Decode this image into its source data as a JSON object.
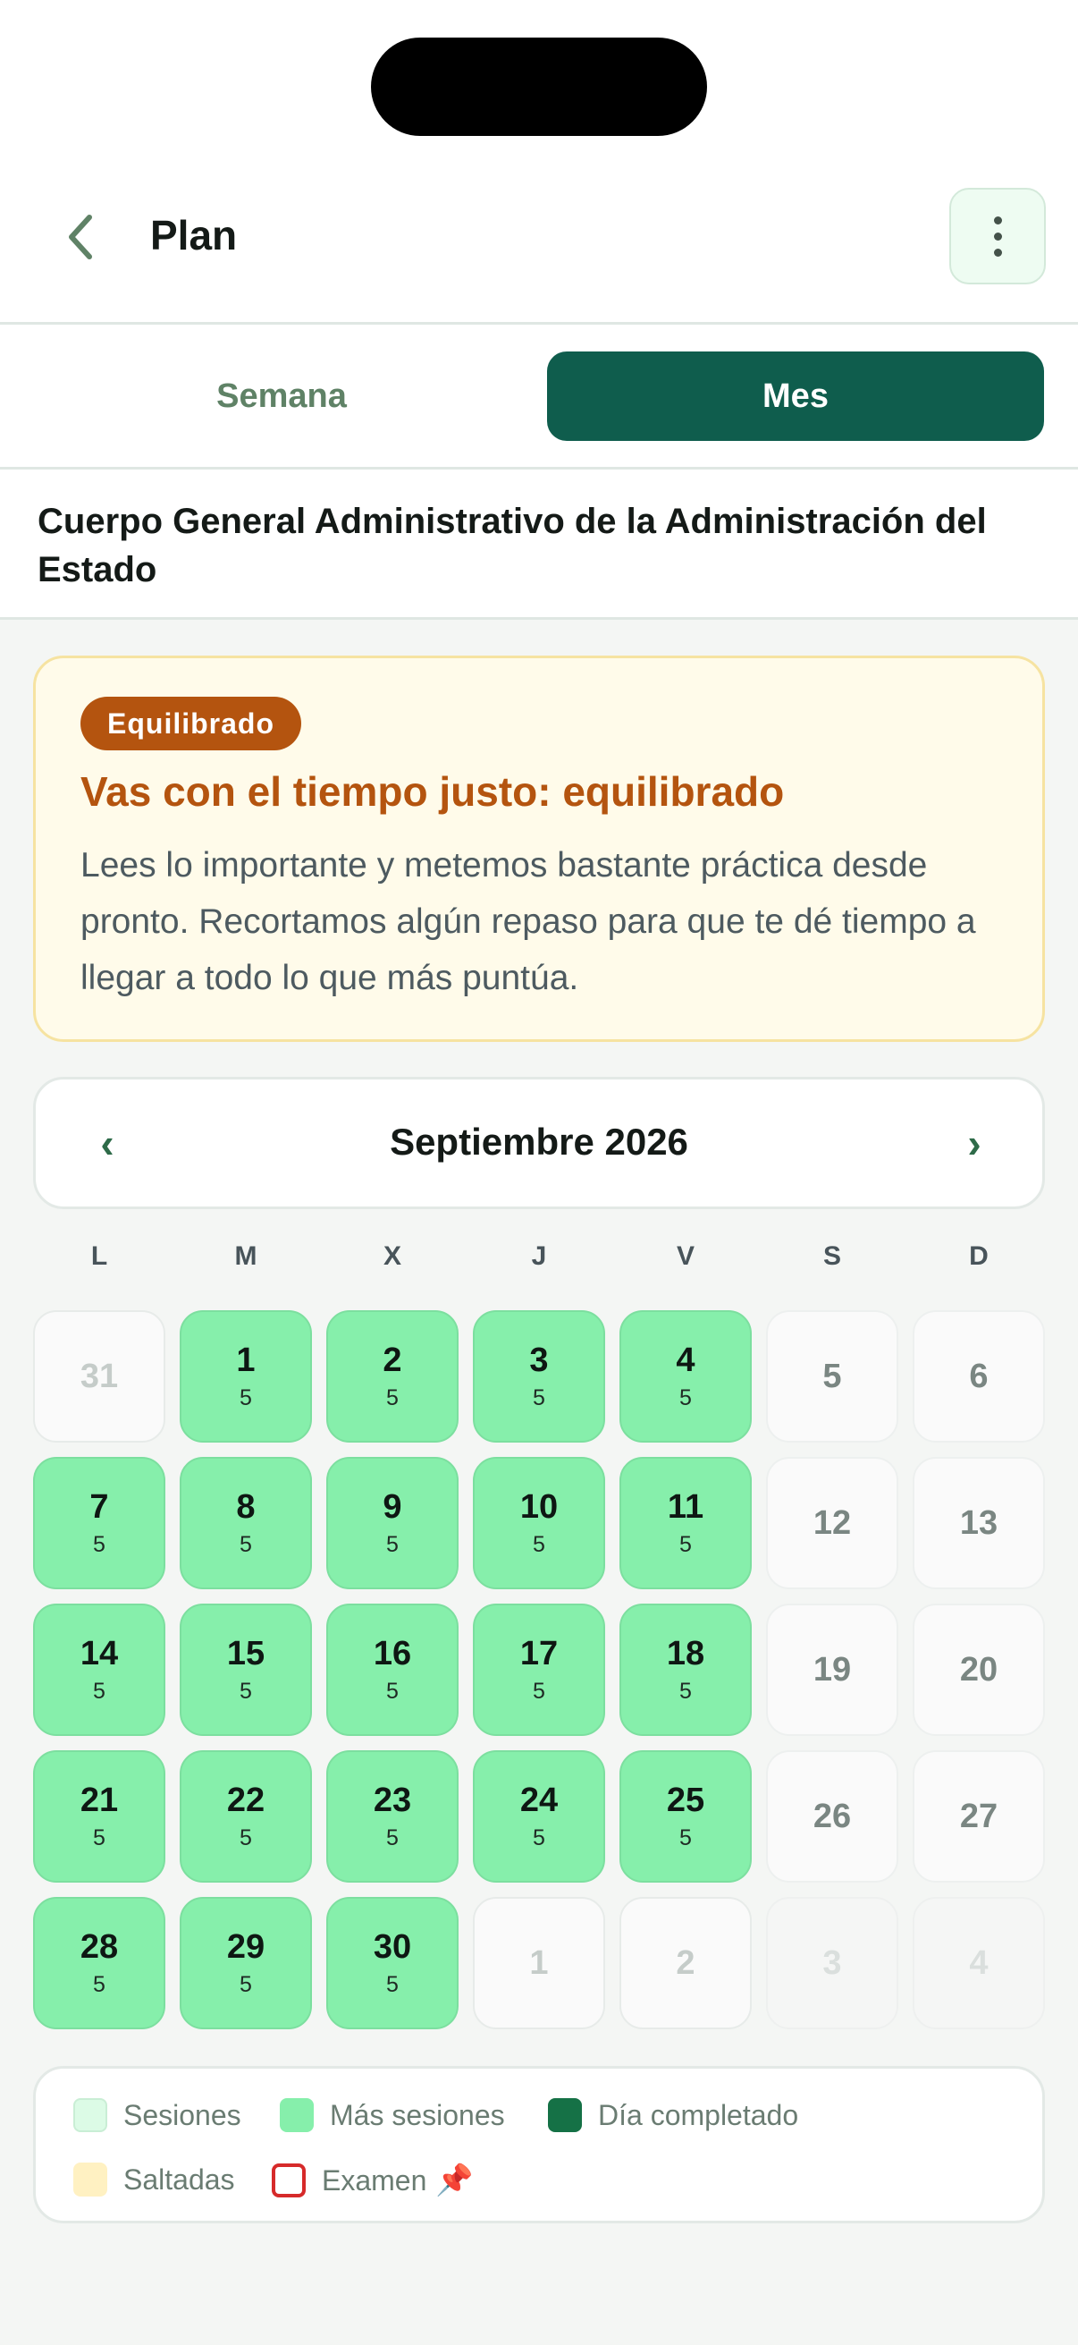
{
  "header": {
    "title": "Plan"
  },
  "tabs": [
    {
      "label": "Semana",
      "active": false
    },
    {
      "label": "Mes",
      "active": true
    }
  ],
  "subtitle": "Cuerpo General Administrativo de la Administración del Estado",
  "notice": {
    "badge": "Equilibrado",
    "title": "Vas con el tiempo justo: equilibrado",
    "body": "Lees lo importante y metemos bastante práctica desde pronto. Recortamos algún repaso para que te dé tiempo a llegar a todo lo que más puntúa."
  },
  "calendar": {
    "month_label": "Septiembre 2026",
    "prev_symbol": "‹",
    "next_symbol": "›",
    "weekdays": [
      "L",
      "M",
      "X",
      "J",
      "V",
      "S",
      "D"
    ],
    "weeks": [
      [
        {
          "day": "31",
          "count": "",
          "state": "outside"
        },
        {
          "day": "1",
          "count": "5",
          "state": "active"
        },
        {
          "day": "2",
          "count": "5",
          "state": "active"
        },
        {
          "day": "3",
          "count": "5",
          "state": "active"
        },
        {
          "day": "4",
          "count": "5",
          "state": "active"
        },
        {
          "day": "5",
          "count": "",
          "state": "weekend"
        },
        {
          "day": "6",
          "count": "",
          "state": "weekend"
        }
      ],
      [
        {
          "day": "7",
          "count": "5",
          "state": "active"
        },
        {
          "day": "8",
          "count": "5",
          "state": "active"
        },
        {
          "day": "9",
          "count": "5",
          "state": "active"
        },
        {
          "day": "10",
          "count": "5",
          "state": "active"
        },
        {
          "day": "11",
          "count": "5",
          "state": "active"
        },
        {
          "day": "12",
          "count": "",
          "state": "weekend"
        },
        {
          "day": "13",
          "count": "",
          "state": "weekend"
        }
      ],
      [
        {
          "day": "14",
          "count": "5",
          "state": "active"
        },
        {
          "day": "15",
          "count": "5",
          "state": "active"
        },
        {
          "day": "16",
          "count": "5",
          "state": "active"
        },
        {
          "day": "17",
          "count": "5",
          "state": "active"
        },
        {
          "day": "18",
          "count": "5",
          "state": "active"
        },
        {
          "day": "19",
          "count": "",
          "state": "weekend"
        },
        {
          "day": "20",
          "count": "",
          "state": "weekend"
        }
      ],
      [
        {
          "day": "21",
          "count": "5",
          "state": "active"
        },
        {
          "day": "22",
          "count": "5",
          "state": "active"
        },
        {
          "day": "23",
          "count": "5",
          "state": "active"
        },
        {
          "day": "24",
          "count": "5",
          "state": "active"
        },
        {
          "day": "25",
          "count": "5",
          "state": "active"
        },
        {
          "day": "26",
          "count": "",
          "state": "weekend"
        },
        {
          "day": "27",
          "count": "",
          "state": "weekend"
        }
      ],
      [
        {
          "day": "28",
          "count": "5",
          "state": "active"
        },
        {
          "day": "29",
          "count": "5",
          "state": "active"
        },
        {
          "day": "30",
          "count": "5",
          "state": "active"
        },
        {
          "day": "1",
          "count": "",
          "state": "outside"
        },
        {
          "day": "2",
          "count": "",
          "state": "outside"
        },
        {
          "day": "3",
          "count": "",
          "state": "outside-soft"
        },
        {
          "day": "4",
          "count": "",
          "state": "outside-soft"
        }
      ]
    ]
  },
  "legend": {
    "sesiones": "Sesiones",
    "mas_sesiones": "Más sesiones",
    "dia_completado": "Día completado",
    "saltadas": "Saltadas",
    "examen": "Examen"
  },
  "icons": {
    "back": "chevron-left-icon",
    "menu": "more-vertical-icon",
    "pin": "pushpin-icon"
  },
  "colors": {
    "accent": "#0f5d4d",
    "session_green": "#86efab",
    "warning_orange": "#b4540f",
    "exam_red": "#d62a2a"
  }
}
